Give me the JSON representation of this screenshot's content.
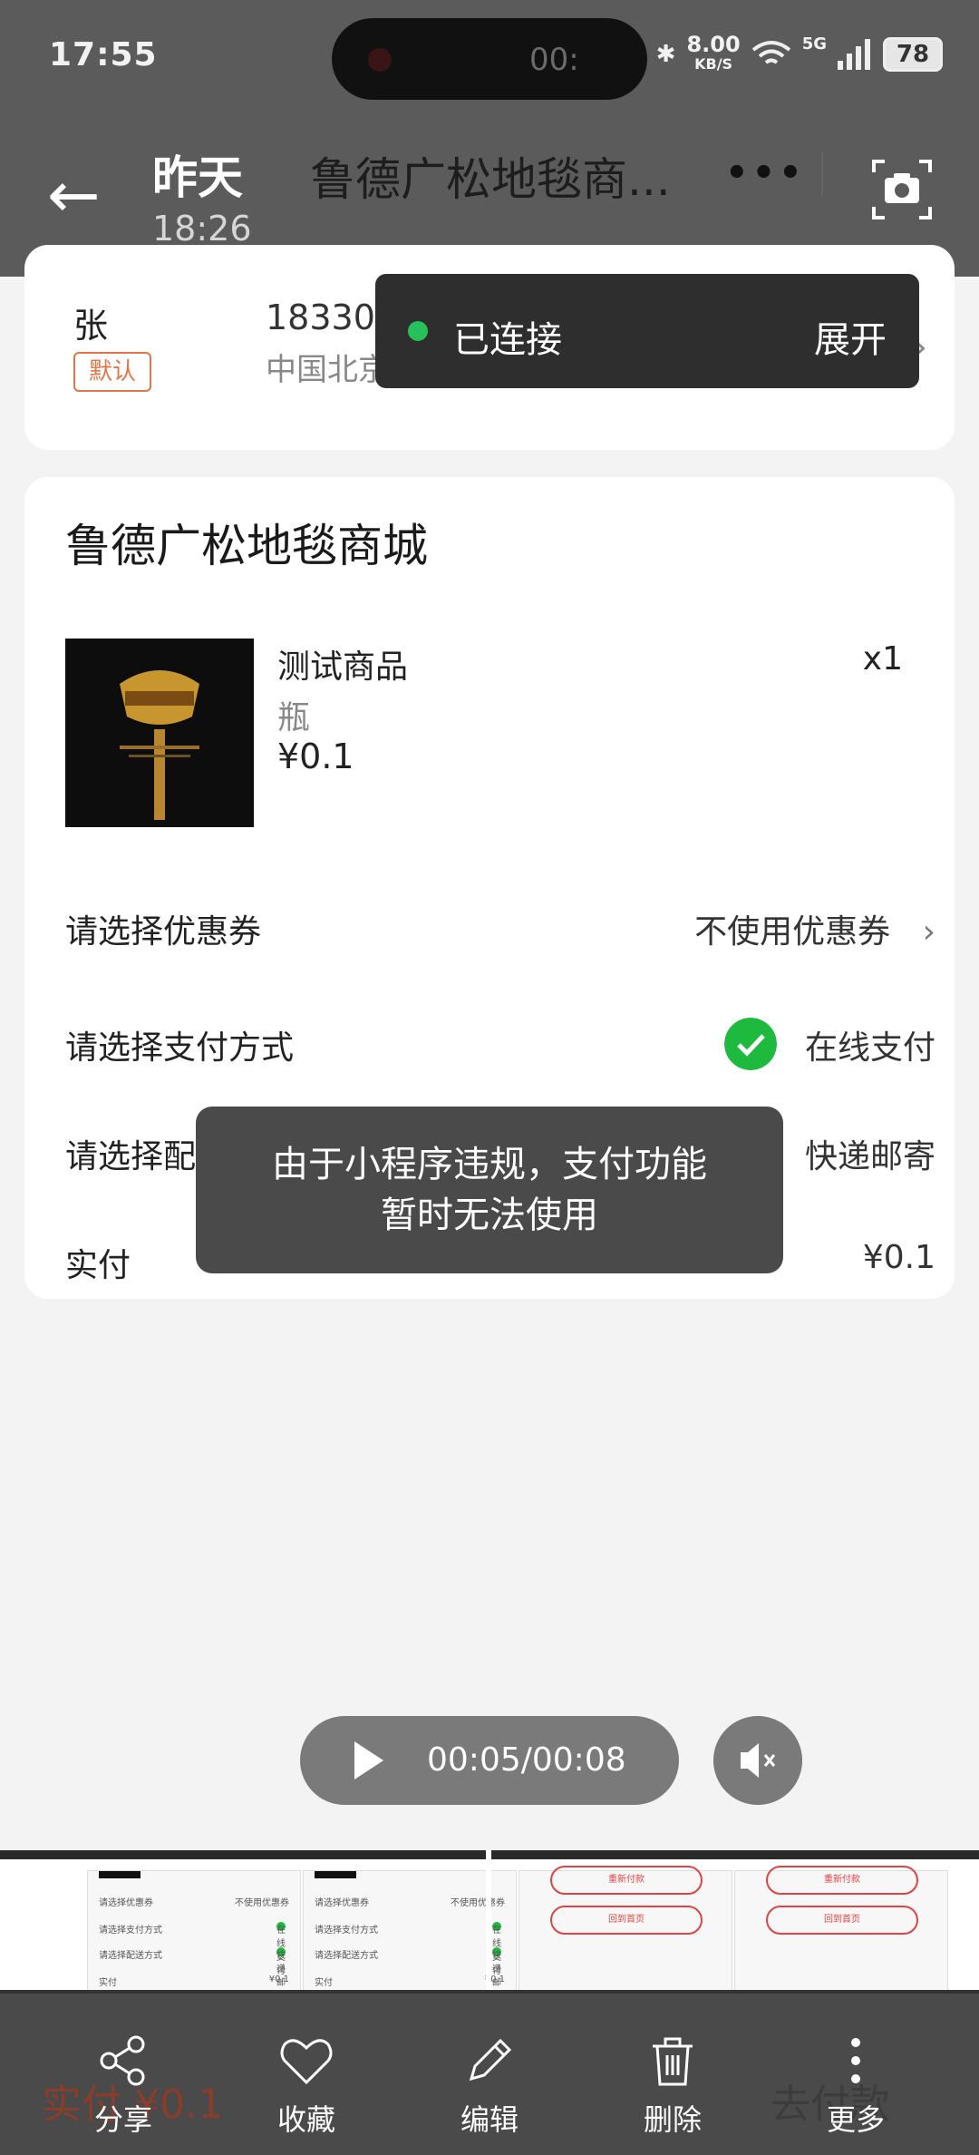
{
  "status": {
    "time": "17:55",
    "recording": "00:",
    "speed": "8.00",
    "speed_unit": "KB/S",
    "network": "5G",
    "battery": "78"
  },
  "header": {
    "day": "昨天",
    "clock": "18:26",
    "title": "鲁德广松地毯商..."
  },
  "connection_toast": {
    "text": "已连接",
    "action": "展开"
  },
  "address": {
    "name": "张",
    "default_tag": "默认",
    "phone": "1833011504",
    "location": "中国北京市东城区测试"
  },
  "order": {
    "shop_name": "鲁德广松地毯商城",
    "product": {
      "name": "测试商品",
      "spec": "瓶",
      "price": "¥0.1",
      "qty": "x1"
    },
    "coupon": {
      "label": "请选择优惠券",
      "value": "不使用优惠券"
    },
    "payment": {
      "label": "请选择支付方式",
      "value": "在线支付"
    },
    "delivery": {
      "label": "请选择配",
      "value": "快递邮寄"
    },
    "total": {
      "label": "实付",
      "value": "¥0.1"
    }
  },
  "pay_toast": {
    "line1": "由于小程序违规，支付功能",
    "line2": "暂时无法使用"
  },
  "player": {
    "timer": "00:05/00:08"
  },
  "timeline": {
    "frame_rows": [
      {
        "l": "请选择优惠券",
        "r": "不使用优惠券"
      },
      {
        "l": "请选择支付方式",
        "r": "在线支付"
      },
      {
        "l": "请选择配送方式",
        "r": "快递邮寄"
      },
      {
        "l": "实付",
        "r": "¥0.1"
      }
    ],
    "btn_top": "重新付款",
    "btn_home": "回到首页"
  },
  "bottom_ghost": {
    "left": "实付 ¥0.1",
    "right": "去付款"
  },
  "toolbar": {
    "share": "分享",
    "favorite": "收藏",
    "edit": "编辑",
    "delete": "删除",
    "more": "更多"
  }
}
